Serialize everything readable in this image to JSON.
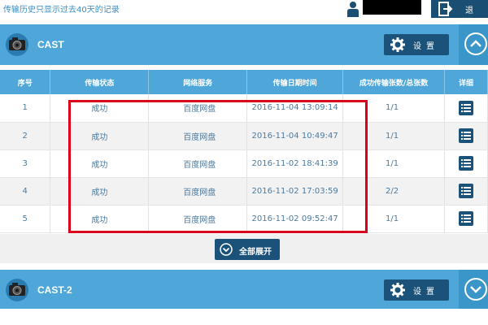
{
  "topbar": {
    "notice": "传输历史只显示过去40天的记录",
    "exit_label": "退出"
  },
  "sections": [
    {
      "title": "CAST",
      "settings_label": "设置",
      "toggle_icon": "chevron-up-icon"
    },
    {
      "title": "CAST-2",
      "settings_label": "设置",
      "toggle_icon": "chevron-down-icon"
    }
  ],
  "table": {
    "headers": [
      "序号",
      "传输状态",
      "网络服务",
      "传输日期时间",
      "成功传输张数/总张数",
      "详细"
    ],
    "rows": [
      {
        "index": "1",
        "status": "成功",
        "service": "百度网盘",
        "datetime": "2016-11-04 13:09:14",
        "ratio": "1/1"
      },
      {
        "index": "2",
        "status": "成功",
        "service": "百度网盘",
        "datetime": "2016-11-04 10:49:47",
        "ratio": "1/1"
      },
      {
        "index": "3",
        "status": "成功",
        "service": "百度网盘",
        "datetime": "2016-11-02 18:41:39",
        "ratio": "1/1"
      },
      {
        "index": "4",
        "status": "成功",
        "service": "百度网盘",
        "datetime": "2016-11-02 17:03:59",
        "ratio": "2/2"
      },
      {
        "index": "5",
        "status": "成功",
        "service": "百度网盘",
        "datetime": "2016-11-02 09:52:47",
        "ratio": "1/1"
      }
    ]
  },
  "expand_all_label": "全部展开",
  "colors": {
    "header_blue": "#4ea7d8",
    "button_navy": "#1a5279",
    "highlight_red": "#d9001b"
  }
}
